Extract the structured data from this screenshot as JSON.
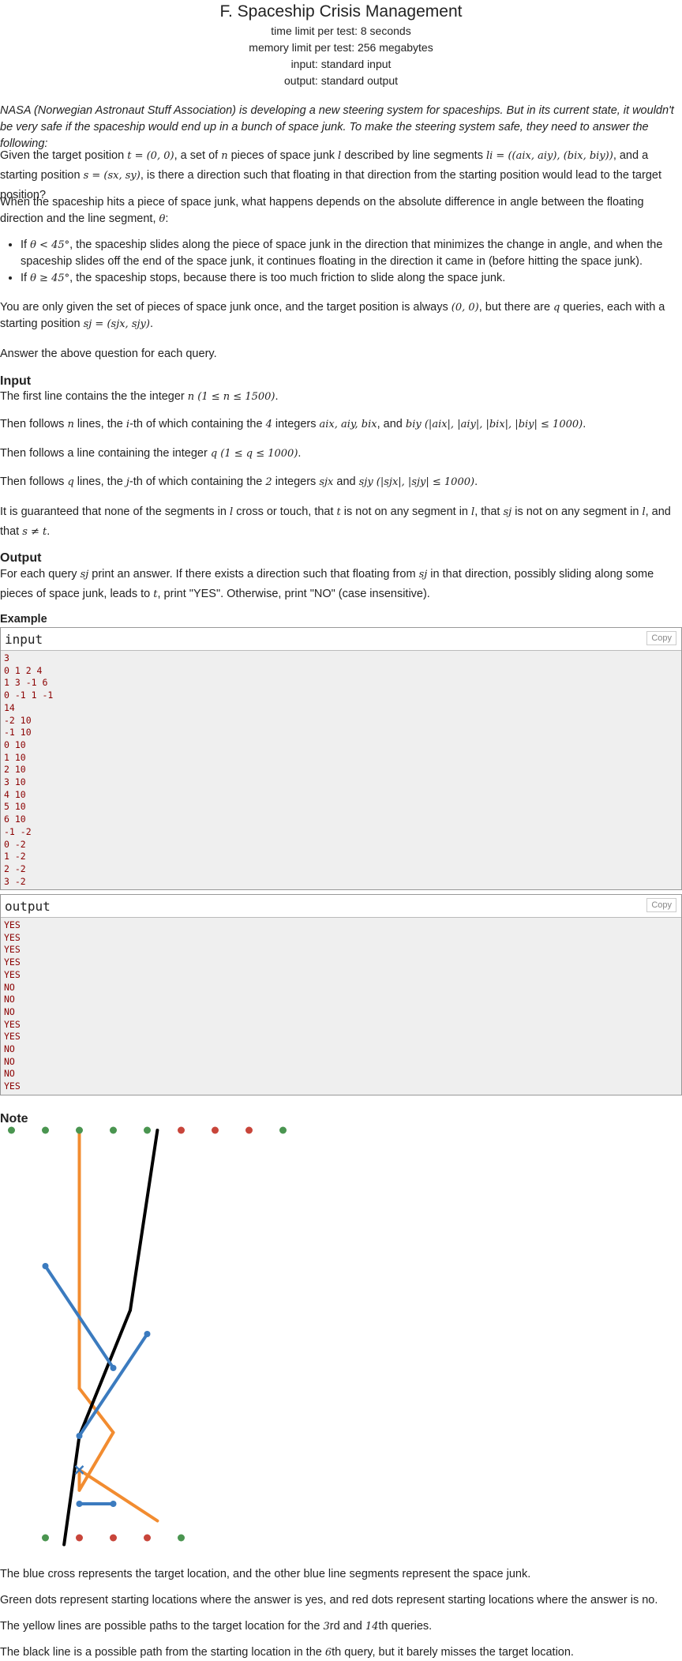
{
  "header": {
    "title": "F. Spaceship Crisis Management",
    "time_limit": "time limit per test: 8 seconds",
    "memory_limit": "memory limit per test: 256 megabytes",
    "input": "input: standard input",
    "output": "output: standard output"
  },
  "legend": {
    "intro": "NASA (Norwegian Astronaut Stuff Association) is developing a new steering system for spaceships. But in its current state, it wouldn't be very safe if the spaceship would end up in a bunch of space junk. To make the steering system safe, they need to answer the following:",
    "p1_a": "Given the target position ",
    "p1_t": "t = (0, 0)",
    "p1_b": ", a set of ",
    "p1_n": "n",
    "p1_c": " pieces of space junk ",
    "p1_l": "l",
    "p1_d": " described by line segments ",
    "p1_seg": "li = ((aix, aiy), (bix, biy))",
    "p1_e": ", and a starting position ",
    "p1_s": "s = (sx, sy)",
    "p1_f": ", is there a direction such that floating in that direction from the starting position would lead to the target position?",
    "p2_a": "When the spaceship hits a piece of space junk, what happens depends on the absolute difference in angle between the floating direction and the line segment, ",
    "p2_theta": "θ",
    "p2_b": ":",
    "li1_a": "If ",
    "li1_m": "θ < 45°",
    "li1_b": ", the spaceship slides along the piece of space junk in the direction that minimizes the change in angle, and when the spaceship slides off the end of the space junk, it continues floating in the direction it came in (before hitting the space junk).",
    "li2_a": "If ",
    "li2_m": "θ ≥ 45°",
    "li2_b": ", the spaceship stops, because there is too much friction to slide along the space junk.",
    "p3_a": "You are only given the set of pieces of space junk once, and the target position is always ",
    "p3_m1": "(0, 0)",
    "p3_b": ", but there are ",
    "p3_q": "q",
    "p3_c": " queries, each with a starting position ",
    "p3_m2": "sj = (sjx, sjy)",
    "p3_d": ".",
    "p4": "Answer the above question for each query."
  },
  "input_section": {
    "heading": "Input",
    "l1_a": "The first line contains the the integer ",
    "l1_m": "n (1 ≤ n ≤ 1500)",
    "l1_b": ".",
    "l2_a": "Then follows ",
    "l2_n": "n",
    "l2_b": " lines, the ",
    "l2_i": "i",
    "l2_c": "-th of which containing the ",
    "l2_4": "4",
    "l2_d": " integers ",
    "l2_m": "aix, aiy, bix",
    "l2_e": ", and ",
    "l2_m2": "biy (|aix|, |aiy|, |bix|, |biy| ≤ 1000)",
    "l2_f": ".",
    "l3_a": "Then follows a line containing the integer ",
    "l3_m": "q (1 ≤ q ≤ 1000)",
    "l3_b": ".",
    "l4_a": "Then follows ",
    "l4_q": "q",
    "l4_b": " lines, the ",
    "l4_j": "j",
    "l4_c": "-th of which containing the ",
    "l4_2": "2",
    "l4_d": " integers ",
    "l4_m": "sjx",
    "l4_e": " and ",
    "l4_m2": "sjy (|sjx|, |sjy| ≤ 1000)",
    "l4_f": ".",
    "l5_a": "It is guaranteed that none of the segments in ",
    "l5_l": "l",
    "l5_b": " cross or touch, that ",
    "l5_t": "t",
    "l5_c": " is not on any segment in ",
    "l5_l2": "l",
    "l5_d": ", that ",
    "l5_sj": "sj",
    "l5_e": " is not on any segment in ",
    "l5_l3": "l",
    "l5_f": ", and that ",
    "l5_m": "s ≠ t",
    "l5_g": "."
  },
  "output_section": {
    "heading": "Output",
    "a": "For each query ",
    "sj": "sj",
    "b": " print an answer. If there exists a direction such that floating from ",
    "sj2": "sj",
    "c": " in that direction, possibly sliding along some pieces of space junk, leads to ",
    "t": "t",
    "d": ", print \"YES\". Otherwise, print \"NO\" (case insensitive)."
  },
  "example": {
    "heading": "Example",
    "input_title": "input",
    "output_title": "output",
    "copy_label": "Copy",
    "input_lines": [
      "3",
      "0 1 2 4",
      "1 3 -1 6",
      "0 -1 1 -1",
      "14",
      "-2 10",
      "-1 10",
      "0 10",
      "1 10",
      "2 10",
      "3 10",
      "4 10",
      "5 10",
      "6 10",
      "-1 -2",
      "0 -2",
      "1 -2",
      "2 -2",
      "3 -2"
    ],
    "output_lines": [
      "YES",
      "YES",
      "YES",
      "YES",
      "YES",
      "NO",
      "NO",
      "NO",
      "YES",
      "YES",
      "NO",
      "NO",
      "NO",
      "YES"
    ]
  },
  "note": {
    "heading": "Note",
    "n1": "The blue cross represents the target location, and the other blue line segments represent the space junk.",
    "n2": "Green dots represent starting locations where the answer is yes, and red dots represent starting locations where the answer is no.",
    "n3_a": "The yellow lines are possible paths to the target location for the ",
    "n3_m1": "3",
    "n3_b": "rd and ",
    "n3_m2": "14",
    "n3_c": "th queries.",
    "n4_a": "The black line is a possible path from the starting location in the ",
    "n4_m": "6",
    "n4_b": "th query, but it barely misses the target location."
  },
  "colors": {
    "green": "#4a9550",
    "red": "#c8453a",
    "blue": "#3b7bbf",
    "orange": "#f28c30",
    "black": "#000000"
  }
}
